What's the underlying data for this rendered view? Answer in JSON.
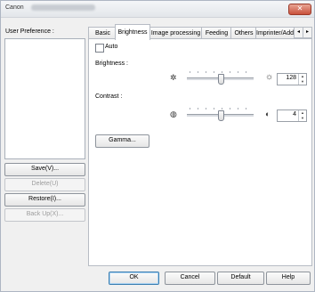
{
  "window": {
    "title": "Canon",
    "close_label": "✕"
  },
  "left": {
    "user_preference_label": "User Preference :",
    "buttons": {
      "save": "Save(V)...",
      "delete": "Delete(U)",
      "restore": "Restore(I)...",
      "backup": "Back Up(X)..."
    }
  },
  "tabs": [
    "Basic",
    "Brightness",
    "Image processing",
    "Feeding",
    "Others",
    "Imprinter/Addo"
  ],
  "tab_scroll": {
    "left": "◂",
    "right": "▸"
  },
  "brightness_tab": {
    "auto_label": "Auto",
    "auto_checked": false,
    "brightness_label": "Brightness :",
    "brightness_value": "128",
    "brightness_level": 0.5,
    "contrast_label": "Contrast :",
    "contrast_value": "4",
    "contrast_level": 0.5,
    "gamma_label": "Gamma...",
    "icons": {
      "brightness_low": "sun-dim-icon",
      "brightness_high": "sun-bright-icon",
      "contrast_low": "contrast-low-icon",
      "contrast_high": "contrast-high-icon"
    }
  },
  "footer": {
    "ok": "OK",
    "cancel": "Cancel",
    "default": "Default",
    "help": "Help"
  }
}
